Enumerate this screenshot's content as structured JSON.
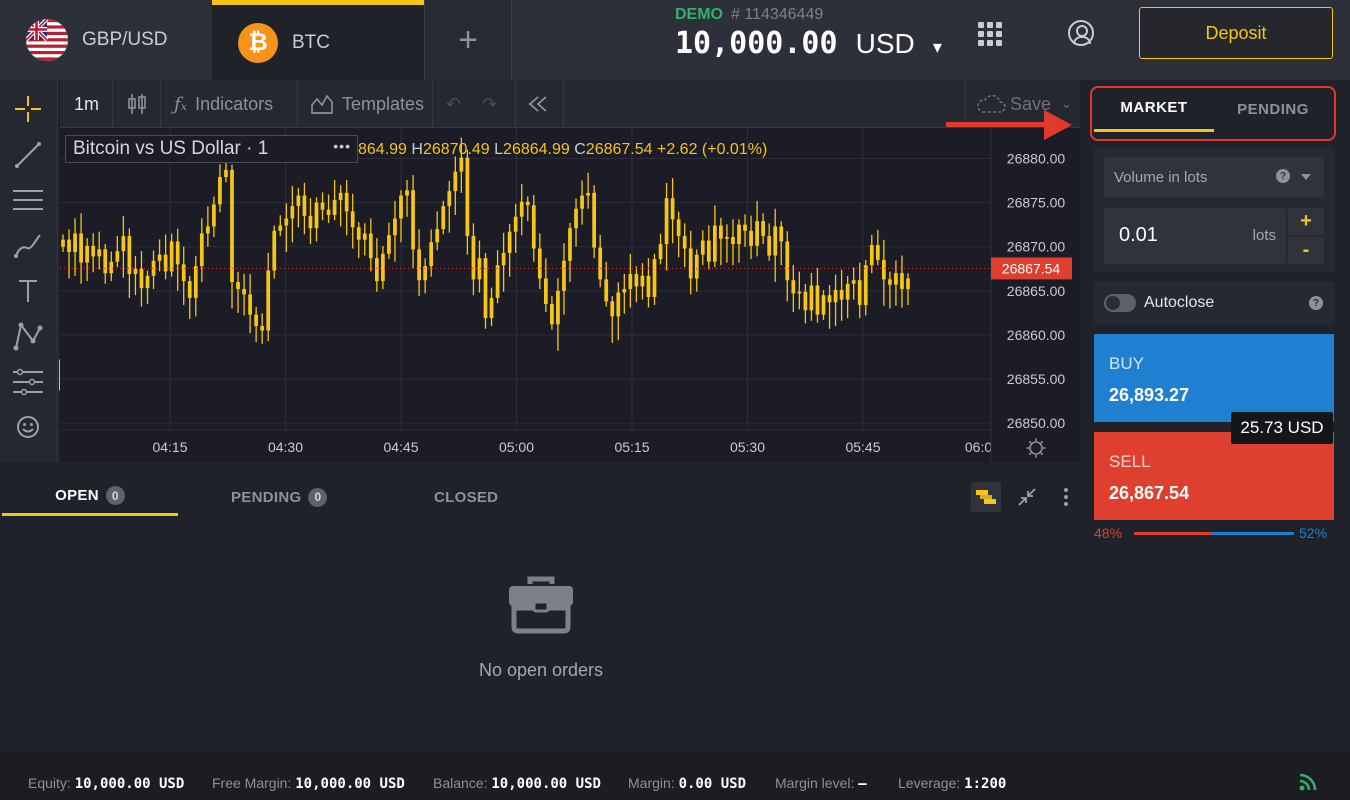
{
  "tabs": [
    {
      "label": "GBP/USD"
    },
    {
      "label": "BTC"
    }
  ],
  "add_tab_label": "+",
  "account": {
    "mode": "DEMO",
    "number": "# 114346449",
    "balance": "10,000.00",
    "currency": "USD"
  },
  "deposit_label": "Deposit",
  "chart_toolbar": {
    "timeframe": "1m",
    "indicators": "Indicators",
    "templates": "Templates",
    "save": "Save"
  },
  "chart_legend": {
    "title": "Bitcoin vs US Dollar · 1",
    "more": "•••",
    "ohlc_text_o": "864.99",
    "h_key": "H",
    "h_val": "26870.49",
    "l_key": "L",
    "l_val": "26864.99",
    "c_key": "C",
    "c_val": "26867.54",
    "change": "+2.62 (+0.01%)"
  },
  "chart_data": {
    "type": "candlestick",
    "ylim": [
      26849,
      26883
    ],
    "y_ticks": [
      "26880.00",
      "26875.00",
      "26870.00",
      "26865.00",
      "26860.00",
      "26855.00",
      "26850.00"
    ],
    "x_ticks": [
      "04:15",
      "04:30",
      "04:45",
      "05:00",
      "05:15",
      "05:30",
      "05:45",
      "06:0"
    ],
    "last_price_label": "26867.54",
    "last_price": 26867.54,
    "color": "#f5c518",
    "close": [
      26870.8,
      26869.4,
      26871.5,
      26868.2,
      26870.1,
      26868.9,
      26869.7,
      26867.0,
      26868.3,
      26869.5,
      26871.2,
      26866.9,
      26867.5,
      26865.3,
      26866.7,
      26868.4,
      26869.1,
      26867.2,
      26870.6,
      26868.0,
      26866.1,
      26864.2,
      26867.8,
      26871.5,
      26872.3,
      26874.8,
      26877.9,
      26878.7,
      26866.0,
      26865.2,
      26864.6,
      26862.3,
      26861.0,
      26860.5,
      26867.3,
      26871.8,
      26872.4,
      26873.2,
      26874.6,
      26875.8,
      26873.5,
      26872.1,
      26875.0,
      26874.2,
      26873.6,
      26875.3,
      26876.1,
      26874.0,
      26872.2,
      26870.8,
      26871.5,
      26868.7,
      26866.1,
      26869.2,
      26871.3,
      26873.2,
      26875.8,
      26876.4,
      26869.7,
      26866.2,
      26867.8,
      26870.5,
      26872.0,
      26874.6,
      26876.3,
      26878.5,
      26880.1,
      26871.2,
      26866.3,
      26868.7,
      26861.9,
      26864.2,
      26867.9,
      26869.3,
      26871.7,
      26873.4,
      26875.1,
      26874.7,
      26869.8,
      26866.4,
      26863.5,
      26861.2,
      26865.0,
      26868.4,
      26872.1,
      26874.3,
      26875.8,
      26876.1,
      26869.9,
      26866.3,
      26863.8,
      26862.1,
      26864.8,
      26865.2,
      26866.9,
      26865.5,
      26866.7,
      26864.3,
      26868.6,
      26870.3,
      26875.5,
      26873.1,
      26871.2,
      26869.8,
      26866.4,
      26869.1,
      26870.7,
      26868.3,
      26872.4,
      26870.9,
      26871.1,
      26870.3,
      26872.5,
      26871.8,
      26870.1,
      26872.9,
      26871.2,
      26869.0,
      26872.3,
      26870.6,
      26866.2,
      26864.7,
      26864.9,
      26862.8,
      26865.6,
      26862.3,
      26864.5,
      26863.7,
      26865.1,
      26864.0,
      26865.8,
      26866.2,
      26863.4,
      26867.9,
      26870.2,
      26868.5,
      26866.3,
      26865.7,
      26867.0,
      26865.2,
      26866.4
    ]
  },
  "tools": [
    "crosshair-tool",
    "trend-line-tool",
    "fib-tool",
    "brush-tool",
    "text-tool",
    "pattern-tool",
    "measure-tool",
    "emoji-tool"
  ],
  "market_tabs": {
    "market": "MARKET",
    "pending": "PENDING"
  },
  "volume": {
    "select_label": "Volume in lots",
    "value": "0.01",
    "unit": "lots",
    "plus": "+",
    "minus": "-"
  },
  "autoclose": {
    "label": "Autoclose"
  },
  "buy": {
    "label": "BUY",
    "price": "26,893.27"
  },
  "sell": {
    "label": "SELL",
    "price": "26,867.54"
  },
  "spread": "25.73 USD",
  "sentiment": {
    "sell_pct": "48%",
    "buy_pct": "52%",
    "sell_fraction": 0.48,
    "buy_fraction": 0.52
  },
  "orders": {
    "tabs": [
      {
        "label": "OPEN",
        "count": "0"
      },
      {
        "label": "PENDING",
        "count": "0"
      },
      {
        "label": "CLOSED"
      }
    ],
    "empty_text": "No open orders"
  },
  "status": {
    "equity_label": "Equity:",
    "equity": "10,000.00 USD",
    "free_margin_label": "Free Margin:",
    "free_margin": "10,000.00 USD",
    "balance_label": "Balance:",
    "balance": "10,000.00 USD",
    "margin_label": "Margin:",
    "margin": "0.00 USD",
    "margin_level_label": "Margin level:",
    "margin_level": "–",
    "leverage_label": "Leverage:",
    "leverage": "1:200"
  },
  "colors": {
    "accent": "#f5c518",
    "buy": "#1f7fd1",
    "sell": "#de3f2f",
    "demo": "#2fb36c",
    "highlight": "#e0392d"
  }
}
